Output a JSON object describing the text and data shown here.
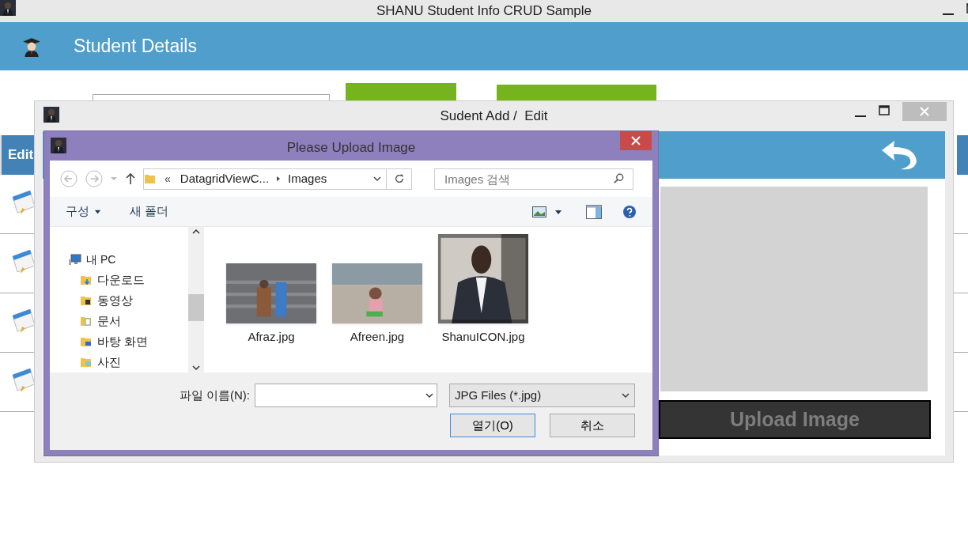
{
  "main_window": {
    "title": "SHANU Student Info CRUD Sample",
    "header": "Student Details",
    "grid": {
      "columns": [
        "Edit"
      ],
      "rows": [
        {
          "kind": "edit"
        },
        {
          "kind": "edit"
        },
        {
          "kind": "edit"
        },
        {
          "kind": "edit"
        }
      ]
    }
  },
  "edit_dialog": {
    "title": "Sudent Add /  Edit",
    "upload_button": "Upload Image"
  },
  "file_dialog": {
    "title": "Please Upload Image",
    "breadcrumb_prefix": "«",
    "path": [
      "DatagridViewC...",
      "Images"
    ],
    "search": {
      "placeholder": "Images 검색"
    },
    "commands": [
      {
        "label": "구성",
        "kind": "menu"
      },
      {
        "label": "새 폴더",
        "kind": "plain"
      }
    ],
    "tree": [
      {
        "label": "내 PC",
        "kind": "pc",
        "children": [
          {
            "label": "다운로드",
            "kind": "download"
          },
          {
            "label": "동영상",
            "kind": "video"
          },
          {
            "label": "문서",
            "kind": "docs"
          },
          {
            "label": "바탕 화면",
            "kind": "desktop"
          },
          {
            "label": "사진",
            "kind": "photos"
          }
        ]
      }
    ],
    "files": [
      {
        "name": "Afraz.jpg",
        "kind": "picture"
      },
      {
        "name": "Afreen.jpg",
        "kind": "picture"
      },
      {
        "name": "ShanuICON.jpg",
        "kind": "picture"
      }
    ],
    "filename_label": "파일 이름(N):",
    "filter": "JPG Files (*.jpg)",
    "buttons": [
      {
        "label": "열기(O)",
        "selected": true
      },
      {
        "label": "취소",
        "selected": false
      }
    ]
  }
}
